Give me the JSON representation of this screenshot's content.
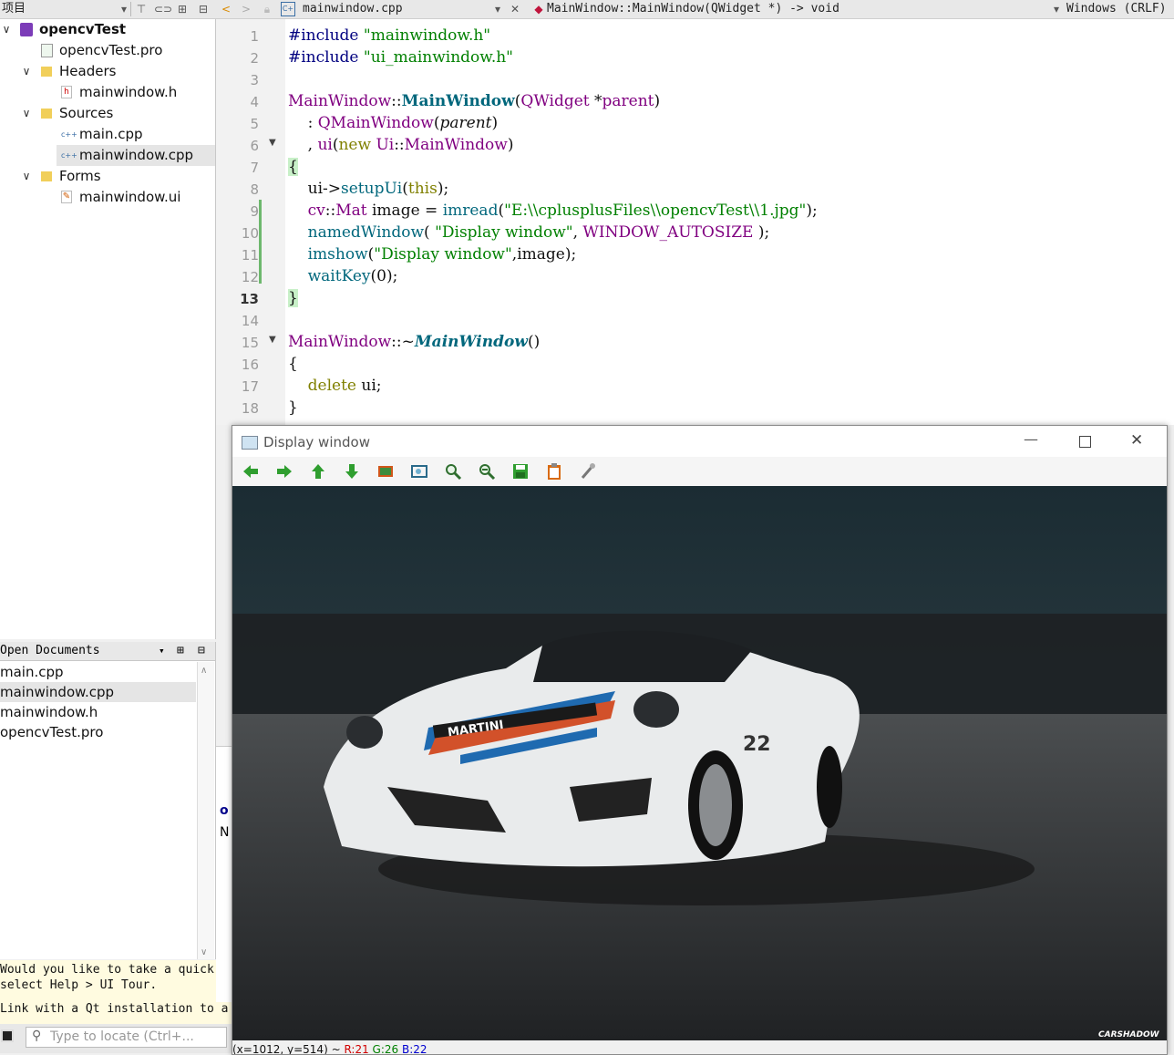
{
  "topbar": {
    "projects_label": "项目",
    "file_name": "mainwindow.cpp",
    "symbol": "MainWindow::MainWindow(QWidget *) -> void",
    "line_ending": "Windows (CRLF)"
  },
  "project_tree": {
    "project": "opencvTest",
    "pro_file": "opencvTest.pro",
    "headers": "Headers",
    "header_file": "mainwindow.h",
    "sources": "Sources",
    "source_main": "main.cpp",
    "source_mainwindow": "mainwindow.cpp",
    "forms": "Forms",
    "form_file": "mainwindow.ui"
  },
  "open_documents": {
    "title": "Open Documents",
    "items": [
      "main.cpp",
      "mainwindow.cpp",
      "mainwindow.h",
      "opencvTest.pro"
    ]
  },
  "info": {
    "line1": "Would you like to take a quick U",
    "line2": "select Help > UI Tour.",
    "line3": "Link with a Qt installation to a"
  },
  "locator": {
    "placeholder": "Type to locate (Ctrl+..."
  },
  "editor": {
    "current_line": 13,
    "lines": [
      {
        "n": "1"
      },
      {
        "n": "2"
      },
      {
        "n": "3"
      },
      {
        "n": "4"
      },
      {
        "n": "5"
      },
      {
        "n": "6"
      },
      {
        "n": "7"
      },
      {
        "n": "8"
      },
      {
        "n": "9"
      },
      {
        "n": "10"
      },
      {
        "n": "11"
      },
      {
        "n": "12"
      },
      {
        "n": "13"
      },
      {
        "n": "14"
      },
      {
        "n": "15"
      },
      {
        "n": "16"
      },
      {
        "n": "17"
      },
      {
        "n": "18"
      }
    ],
    "code": {
      "l1_a": "#include ",
      "l1_b": "\"mainwindow.h\"",
      "l2_a": "#include ",
      "l2_b": "\"ui_mainwindow.h\"",
      "l4_a": "MainWindow",
      "l4_b": "::",
      "l4_c": "MainWindow",
      "l4_d": "(",
      "l4_e": "QWidget",
      "l4_f": " *",
      "l4_g": "parent",
      "l4_h": ")",
      "l5_a": "    : ",
      "l5_b": "QMainWindow",
      "l5_c": "(",
      "l5_d": "parent",
      "l5_e": ")",
      "l6_a": "    , ",
      "l6_b": "ui",
      "l6_c": "(",
      "l6_d": "new ",
      "l6_e": "Ui",
      "l6_f": "::",
      "l6_g": "MainWindow",
      "l6_h": ")",
      "l7": "{",
      "l8_a": "    ui->",
      "l8_b": "setupUi",
      "l8_c": "(",
      "l8_d": "this",
      "l8_e": ");",
      "l9_a": "    cv",
      "l9_b": "::",
      "l9_c": "Mat",
      "l9_d": " image = ",
      "l9_e": "imread",
      "l9_f": "(",
      "l9_g": "\"E:\\\\cplusplusFiles\\\\opencvTest\\\\1.jpg\"",
      "l9_h": ");",
      "l10_a": "    ",
      "l10_b": "namedWindow",
      "l10_c": "( ",
      "l10_d": "\"Display window\"",
      "l10_e": ", ",
      "l10_f": "WINDOW_AUTOSIZE",
      "l10_g": " );",
      "l11_a": "    ",
      "l11_b": "imshow",
      "l11_c": "(",
      "l11_d": "\"Display window\"",
      "l11_e": ",image);",
      "l12_a": "    ",
      "l12_b": "waitKey",
      "l12_c": "(0);",
      "l13": "}",
      "l15_a": "MainWindow",
      "l15_b": "::~",
      "l15_c": "MainWindow",
      "l15_d": "()",
      "l16": "{",
      "l17_a": "    ",
      "l17_b": "delete",
      "l17_c": " ui;",
      "l18": "}"
    }
  },
  "output_fragments": {
    "a": "o",
    "b": "N"
  },
  "display_window": {
    "title": "Display window",
    "status_coords": "(x=1012, y=514) ~ ",
    "status_r": "R:21",
    "status_g": "G:26",
    "status_b": "B:22",
    "watermark": "CARSHADOW",
    "car_label": "MARTINI",
    "car_number": "22"
  },
  "colors": {
    "accent_green": "#2f9e2f",
    "string_green": "#008000",
    "preproc_navy": "#000080"
  }
}
